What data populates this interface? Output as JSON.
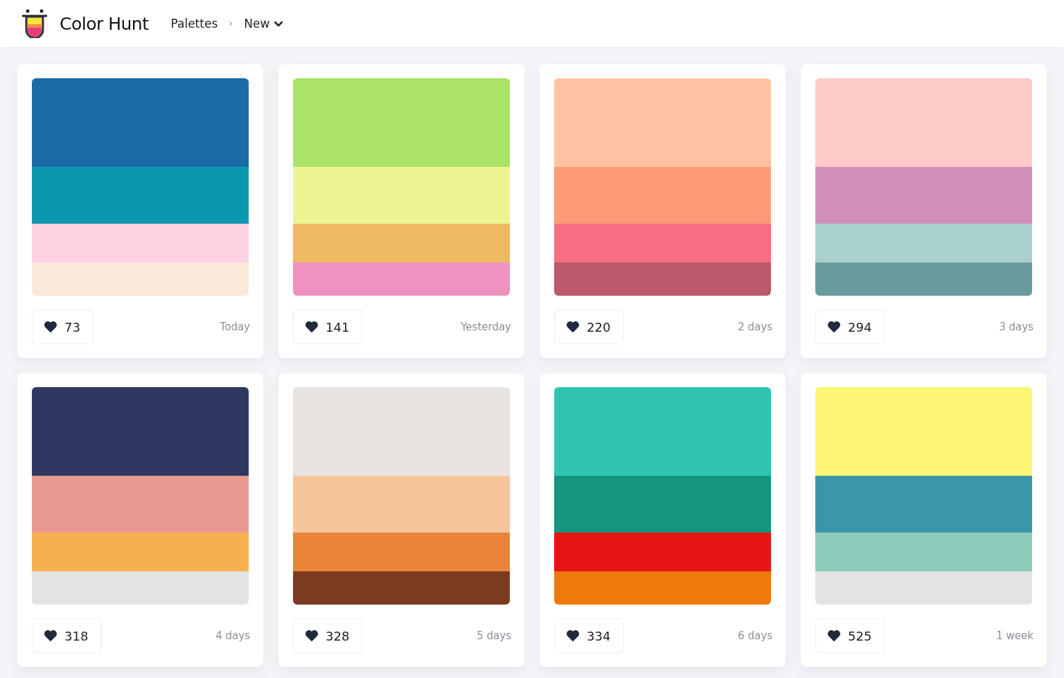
{
  "header": {
    "brand": "Color Hunt",
    "breadcrumb": "Palettes",
    "separator": "›",
    "filter": "New"
  },
  "palettes": [
    {
      "swatches": [
        {
          "color": "#1c6ba6"
        },
        {
          "color": "#0b97b0"
        },
        {
          "color": "#ffd3e3"
        },
        {
          "color": "#fce8d8"
        }
      ],
      "likes": "73",
      "age": "Today"
    },
    {
      "swatches": [
        {
          "color": "#aae366"
        },
        {
          "color": "#edf494"
        },
        {
          "color": "#edb961"
        },
        {
          "color": "#ee93bf"
        }
      ],
      "likes": "141",
      "age": "Yesterday"
    },
    {
      "swatches": [
        {
          "color": "#ffc3a3"
        },
        {
          "color": "#ff9a77"
        },
        {
          "color": "#f76f81"
        },
        {
          "color": "#bb5a6a"
        }
      ],
      "likes": "220",
      "age": "2 days"
    },
    {
      "swatches": [
        {
          "color": "#ffcbca"
        },
        {
          "color": "#d28fba"
        },
        {
          "color": "#aad0cd"
        },
        {
          "color": "#689c9c"
        }
      ],
      "likes": "294",
      "age": "3 days"
    },
    {
      "swatches": [
        {
          "color": "#2f3860"
        },
        {
          "color": "#e89992"
        },
        {
          "color": "#f6b04e"
        },
        {
          "color": "#e3e3e3"
        }
      ],
      "likes": "318",
      "age": "4 days"
    },
    {
      "swatches": [
        {
          "color": "#e7e3e0"
        },
        {
          "color": "#f7c59b"
        },
        {
          "color": "#e9843a"
        },
        {
          "color": "#7c3b20"
        }
      ],
      "likes": "328",
      "age": "5 days"
    },
    {
      "swatches": [
        {
          "color": "#30c5b1"
        },
        {
          "color": "#14957f"
        },
        {
          "color": "#e71515"
        },
        {
          "color": "#f0790b"
        }
      ],
      "likes": "334",
      "age": "6 days"
    },
    {
      "swatches": [
        {
          "color": "#fbf674"
        },
        {
          "color": "#3a97a7"
        },
        {
          "color": "#8fcbbb"
        },
        {
          "color": "#e3e3e3"
        }
      ],
      "likes": "525",
      "age": "1 week"
    }
  ]
}
